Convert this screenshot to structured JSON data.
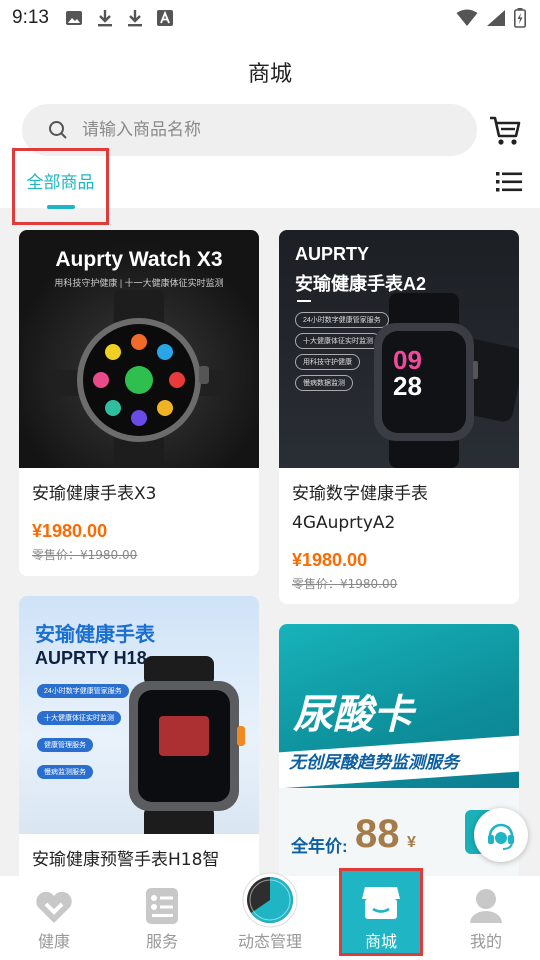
{
  "status_bar": {
    "time": "9:13"
  },
  "header": {
    "title": "商城",
    "search_placeholder": "请输入商品名称",
    "tab_all": "全部商品"
  },
  "products": [
    {
      "name": "安瑜健康手表X3",
      "price": "¥1980.00",
      "retail": "零售价：¥1980.00",
      "image_text": {
        "headline": "Auprty Watch X3",
        "sub": "用科技守护健康 | 十一大健康体征实时监测"
      }
    },
    {
      "name": "安瑜数字健康手表4GAuprtyA2",
      "price": "¥1980.00",
      "retail": "零售价：¥1980.00",
      "image_text": {
        "brand": "AUPRTY",
        "headline": "安瑜健康手表A2",
        "features": [
          "24小时数字健康管家服务",
          "十大健康体征实时监测",
          "用科技守护健康",
          "慢病数据监测"
        ],
        "watch_time_h": "09",
        "watch_time_m": "28"
      }
    },
    {
      "name": "安瑜健康预警手表H18智",
      "image_text": {
        "headline": "安瑜健康手表",
        "model": "AUPRTY H18",
        "features": [
          "24小时数字健康管家服务",
          "十大健康体征实时监测",
          "健康管理服务",
          "慢病监测服务"
        ]
      }
    },
    {
      "name": "",
      "image_text": {
        "headline": "尿酸卡",
        "sub": "无创尿酸趋势监测服务",
        "price_label": "全年价:",
        "price_value": "88",
        "price_unit": "¥"
      }
    }
  ],
  "bottom_nav": [
    {
      "label": "健康",
      "icon": "heart-icon"
    },
    {
      "label": "服务",
      "icon": "service-list-icon"
    },
    {
      "label": "动态管理",
      "icon": "dynamic-ring-icon"
    },
    {
      "label": "商城",
      "icon": "shop-icon",
      "active": true
    },
    {
      "label": "我的",
      "icon": "person-icon"
    }
  ],
  "colors": {
    "accent": "#20b5c4",
    "price": "#ff6a00",
    "highlight_box": "#e03b3b"
  }
}
